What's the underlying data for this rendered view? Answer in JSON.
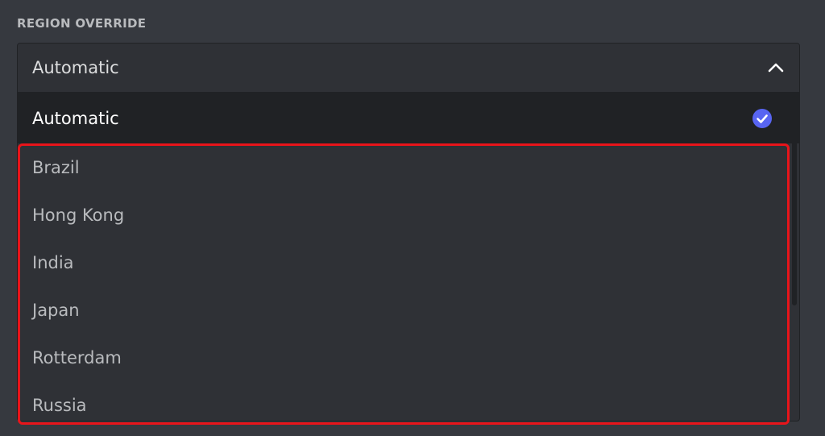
{
  "section": {
    "label": "REGION OVERRIDE"
  },
  "select": {
    "current_value": "Automatic",
    "expanded": true,
    "options": [
      {
        "label": "Automatic",
        "selected": true
      },
      {
        "label": "Brazil",
        "selected": false
      },
      {
        "label": "Hong Kong",
        "selected": false
      },
      {
        "label": "India",
        "selected": false
      },
      {
        "label": "Japan",
        "selected": false
      },
      {
        "label": "Rotterdam",
        "selected": false
      },
      {
        "label": "Russia",
        "selected": false
      }
    ]
  },
  "icons": {
    "chevron": "chevron-up-icon",
    "check": "check-circle-icon"
  },
  "colors": {
    "background": "#36393f",
    "dropdown": "#2f3136",
    "selected_option": "#202225",
    "accent": "#5865f2",
    "highlight": "#e8141a"
  }
}
